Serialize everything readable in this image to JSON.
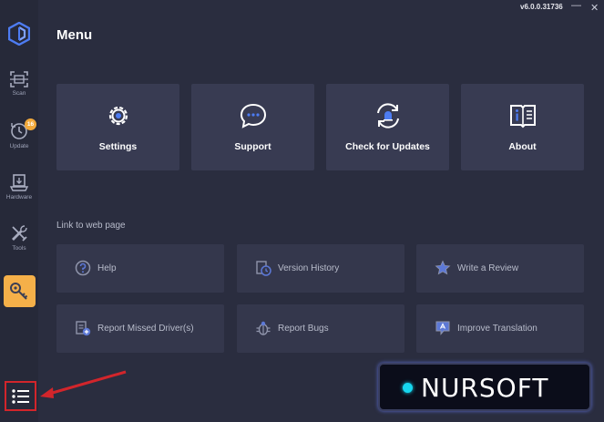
{
  "window": {
    "version": "v6.0.0.31736",
    "minimize_glyph": "—",
    "close_glyph": "✕"
  },
  "colors": {
    "accent_blue": "#4d7cf2",
    "key_orange": "#f5b049",
    "badge_orange": "#f2a93b",
    "highlight_red": "#d2252b"
  },
  "sidebar": {
    "items": [
      {
        "label": "Scan",
        "icon": "scan-icon"
      },
      {
        "label": "Update",
        "icon": "update-icon",
        "badge": "16"
      },
      {
        "label": "Hardware",
        "icon": "hardware-icon"
      },
      {
        "label": "Tools",
        "icon": "tools-icon"
      }
    ],
    "key_icon": "key-icon",
    "menu_icon": "menu-list-icon"
  },
  "page": {
    "title": "Menu"
  },
  "cards": [
    {
      "label": "Settings",
      "icon": "gear-icon"
    },
    {
      "label": "Support",
      "icon": "chat-bubble-icon"
    },
    {
      "label": "Check for Updates",
      "icon": "refresh-bell-icon"
    },
    {
      "label": "About",
      "icon": "info-book-icon"
    }
  ],
  "links_section": {
    "title": "Link to web page",
    "links": [
      {
        "label": "Help",
        "icon": "help-icon"
      },
      {
        "label": "Version History",
        "icon": "history-icon"
      },
      {
        "label": "Write a Review",
        "icon": "star-icon"
      },
      {
        "label": "Report Missed Driver(s)",
        "icon": "report-driver-icon"
      },
      {
        "label": "Report Bugs",
        "icon": "bug-icon"
      },
      {
        "label": "Improve Translation",
        "icon": "translate-icon"
      }
    ]
  },
  "watermark": {
    "text": "NURSOFT"
  }
}
